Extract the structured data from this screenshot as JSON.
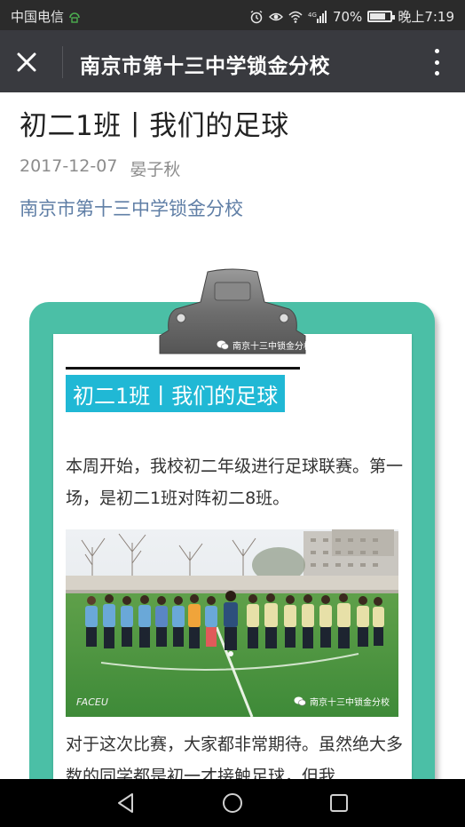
{
  "status_bar": {
    "carrier": "中国电信",
    "battery": "70%",
    "time": "晚上7:19",
    "signal_label": "4G",
    "battery_level": 0.7
  },
  "title_bar": {
    "title": "南京市第十三中学锁金分校"
  },
  "article": {
    "title": "初二1班丨我们的足球",
    "date": "2017-12-07",
    "author": "晏子秋",
    "account": "南京市第十三中学锁金分校"
  },
  "content": {
    "clip_watermark": "南京十三中锁金分校",
    "section_title": "初二1班丨我们的足球",
    "paragraph1": "本周开始，我校初二年级进行足球联赛。第一场，是初二1班对阵初二8班。",
    "photo_watermark": "南京十三中锁金分校",
    "photo_brand": "FACEU",
    "paragraph2": "对于这次比赛，大家都非常期待。虽然绝大多数的同学都是初一才接触足球，但我"
  },
  "colors": {
    "board": "#4bbfa6",
    "section_highlight": "#20b8d5",
    "link": "#607fa6",
    "titlebar": "#393a3f"
  }
}
